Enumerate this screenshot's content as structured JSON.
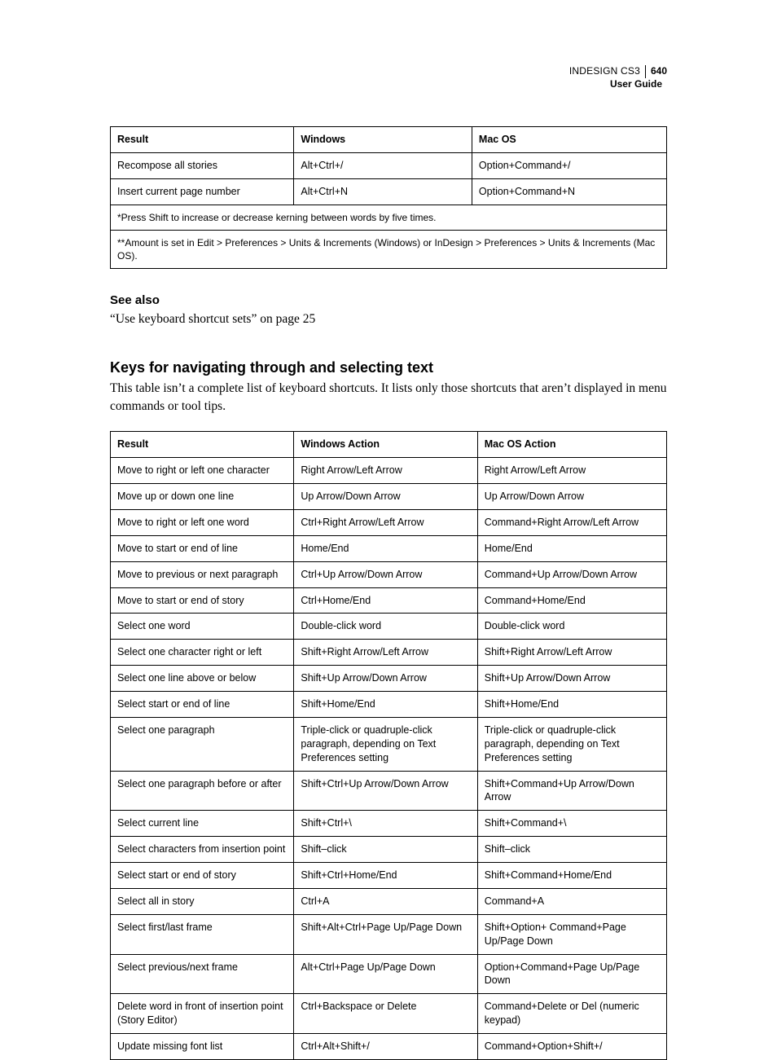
{
  "header": {
    "product": "INDESIGN CS3",
    "page_number": "640",
    "guide_label": "User Guide"
  },
  "table1": {
    "headers": {
      "result": "Result",
      "windows": "Windows",
      "mac": "Mac OS"
    },
    "rows": [
      {
        "result": "Recompose all stories",
        "windows": "Alt+Ctrl+/",
        "mac": "Option+Command+/"
      },
      {
        "result": "Insert current page number",
        "windows": "Alt+Ctrl+N",
        "mac": "Option+Command+N"
      }
    ],
    "footnotes": [
      "*Press Shift to increase or decrease kerning between words by five times.",
      "**Amount is set in Edit > Preferences > Units & Increments (Windows) or InDesign > Preferences > Units & Increments (Mac OS)."
    ]
  },
  "see_also": {
    "heading": "See also",
    "link_text": "“Use keyboard shortcut sets” on page 25"
  },
  "section2": {
    "heading": "Keys for navigating through and selecting text",
    "intro": "This table isn’t a complete list of keyboard shortcuts. It lists only those shortcuts that aren’t displayed in menu commands or tool tips."
  },
  "table2": {
    "headers": {
      "result": "Result",
      "windows": "Windows Action",
      "mac": "Mac OS Action"
    },
    "rows": [
      {
        "result": "Move to right or left one character",
        "windows": "Right Arrow/Left Arrow",
        "mac": "Right Arrow/Left Arrow"
      },
      {
        "result": "Move up or down one line",
        "windows": "Up Arrow/Down Arrow",
        "mac": "Up Arrow/Down Arrow"
      },
      {
        "result": "Move to right or left one word",
        "windows": "Ctrl+Right Arrow/Left Arrow",
        "mac": "Command+Right Arrow/Left Arrow"
      },
      {
        "result": "Move to start or end of line",
        "windows": "Home/End",
        "mac": "Home/End"
      },
      {
        "result": "Move to previous or next paragraph",
        "windows": "Ctrl+Up Arrow/Down Arrow",
        "mac": "Command+Up Arrow/Down Arrow"
      },
      {
        "result": "Move to start or end of story",
        "windows": "Ctrl+Home/End",
        "mac": "Command+Home/End"
      },
      {
        "result": "Select one word",
        "windows": "Double-click word",
        "mac": "Double-click word"
      },
      {
        "result": "Select one character right or left",
        "windows": "Shift+Right Arrow/Left Arrow",
        "mac": "Shift+Right Arrow/Left Arrow"
      },
      {
        "result": "Select one line above or below",
        "windows": "Shift+Up Arrow/Down Arrow",
        "mac": "Shift+Up Arrow/Down Arrow"
      },
      {
        "result": "Select start or end of line",
        "windows": "Shift+Home/End",
        "mac": "Shift+Home/End"
      },
      {
        "result": "Select one paragraph",
        "windows": "Triple-click or quadruple-click paragraph, depending on Text Preferences setting",
        "mac": "Triple-click or quadruple-click paragraph, depending on Text Preferences setting"
      },
      {
        "result": "Select one paragraph before or after",
        "windows": "Shift+Ctrl+Up Arrow/Down Arrow",
        "mac": "Shift+Command+Up Arrow/Down Arrow"
      },
      {
        "result": "Select current line",
        "windows": "Shift+Ctrl+\\",
        "mac": "Shift+Command+\\"
      },
      {
        "result": "Select characters from insertion point",
        "windows": "Shift–click",
        "mac": "Shift–click"
      },
      {
        "result": "Select start or end of story",
        "windows": "Shift+Ctrl+Home/End",
        "mac": "Shift+Command+Home/End"
      },
      {
        "result": "Select all in story",
        "windows": "Ctrl+A",
        "mac": "Command+A"
      },
      {
        "result": "Select first/last frame",
        "windows": "Shift+Alt+Ctrl+Page Up/Page Down",
        "mac": "Shift+Option+ Command+Page Up/Page Down"
      },
      {
        "result": "Select previous/next frame",
        "windows": "Alt+Ctrl+Page Up/Page Down",
        "mac": "Option+Command+Page Up/Page Down"
      },
      {
        "result": "Delete word in front of insertion point (Story Editor)",
        "windows": "Ctrl+Backspace or Delete",
        "mac": "Command+Delete or Del (numeric keypad)"
      },
      {
        "result": "Update missing font list",
        "windows": "Ctrl+Alt+Shift+/",
        "mac": "Command+Option+Shift+/"
      }
    ]
  }
}
